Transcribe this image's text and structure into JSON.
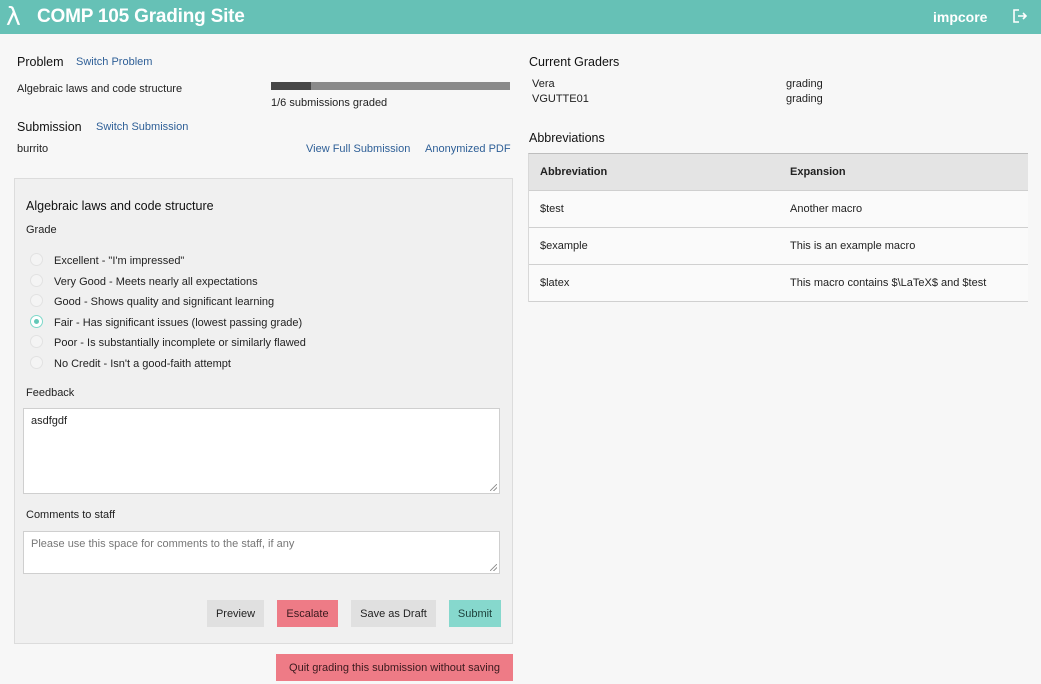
{
  "header": {
    "logo_glyph": "λ",
    "title": "COMP 105 Grading Site",
    "course": "impcore",
    "logout_icon": "logout-icon"
  },
  "problem": {
    "heading": "Problem",
    "switch_label": "Switch Problem",
    "name": "Algebraic laws and code structure",
    "progress_text": "1/6 submissions graded",
    "graded": 1,
    "total": 6
  },
  "submission": {
    "heading": "Submission",
    "switch_label": "Switch Submission",
    "name": "burrito",
    "view_full_label": "View Full Submission",
    "anon_pdf_label": "Anonymized PDF"
  },
  "grading_form": {
    "title": "Algebraic laws and code structure",
    "grade_label": "Grade",
    "grades": [
      {
        "label": "Excellent - \"I'm impressed\"",
        "checked": false
      },
      {
        "label": "Very Good - Meets nearly all expectations",
        "checked": false
      },
      {
        "label": "Good - Shows quality and significant learning",
        "checked": false
      },
      {
        "label": "Fair - Has significant issues (lowest passing grade)",
        "checked": true
      },
      {
        "label": "Poor - Is substantially incomplete or similarly flawed",
        "checked": false
      },
      {
        "label": "No Credit - Isn't a good-faith attempt",
        "checked": false
      }
    ],
    "feedback_label": "Feedback",
    "feedback_value": "asdfgdf",
    "comments_label": "Comments to staff",
    "comments_value": "",
    "comments_placeholder": "Please use this space for comments to the staff, if any",
    "buttons": {
      "preview": "Preview",
      "escalate": "Escalate",
      "save_draft": "Save as Draft",
      "submit": "Submit"
    }
  },
  "quit_label": "Quit grading this submission without saving",
  "current_graders": {
    "heading": "Current Graders",
    "rows": [
      {
        "name": "Vera",
        "status": "grading"
      },
      {
        "name": "VGUTTE01",
        "status": "grading"
      }
    ]
  },
  "abbreviations": {
    "heading": "Abbreviations",
    "columns": [
      "Abbreviation",
      "Expansion"
    ],
    "rows": [
      {
        "abbr": "$test",
        "expansion": "Another macro"
      },
      {
        "abbr": "$example",
        "expansion": "This is an example macro"
      },
      {
        "abbr": "$latex",
        "expansion": "This macro contains $\\LaTeX$ and $test"
      }
    ]
  },
  "colors": {
    "header": "#66c1b6",
    "link": "#2e5f97",
    "escalate": "#ee7b86",
    "submit": "#86d8cd"
  }
}
